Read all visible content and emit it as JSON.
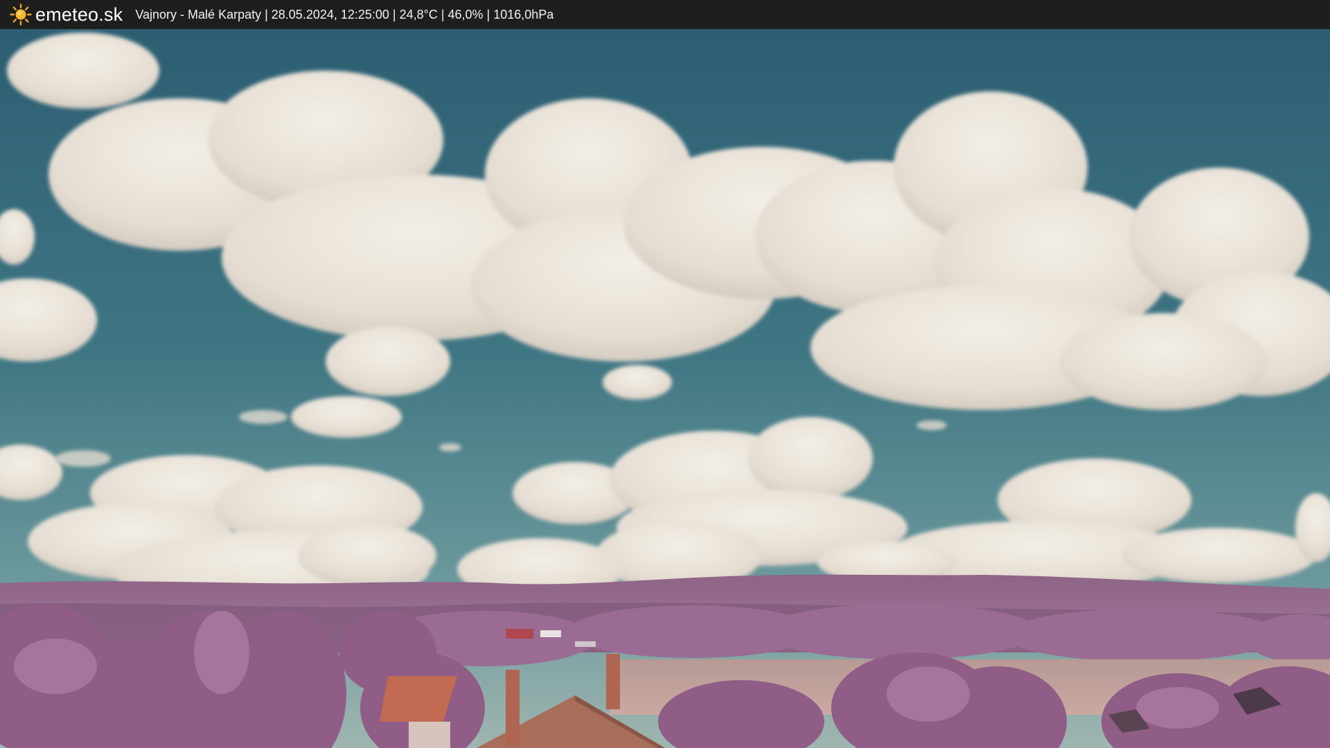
{
  "topbar": {
    "brand": "emeteo.sk",
    "logo_icon": "sun-icon",
    "caption": "Vajnory - Malé Karpaty | 28.05.2024, 12:25:00 | 24,8°C | 46,0% | 1016,0hPa"
  },
  "colors": {
    "bar_background": "#1e1e1e",
    "sun": "#f5a623",
    "sky_top": "#2f6173",
    "sky_bottom": "#5e8f96",
    "cloud": "#ece6dc",
    "vegetation": "#a06c93",
    "roof": "#c8745a"
  }
}
